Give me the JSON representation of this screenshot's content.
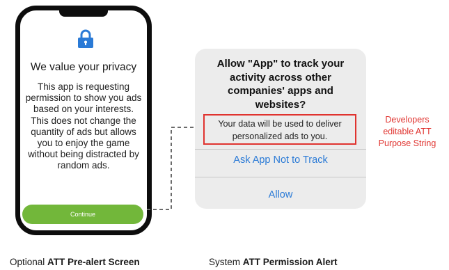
{
  "pre_alert": {
    "title": "We value your privacy",
    "body": "This app is requesting permission to show you ads based on your interests. This does not change the quantity of ads but allows you to enjoy the game without being distracted by random ads.",
    "continue_label": "Continue",
    "icon": "lock-icon",
    "accent_color": "#2a7ad6",
    "button_color": "#72b73a"
  },
  "att_alert": {
    "title": "Allow \"App\" to track your activity across other companies' apps and websites?",
    "purpose_string": "Your data will be used to deliver personalized ads to you.",
    "ask_not_to_track_label": "Ask App Not to Track",
    "allow_label": "Allow",
    "highlight_color": "#e0332f"
  },
  "annotation": {
    "text": "Developers editable ATT Purpose String"
  },
  "captions": {
    "left_prefix": "Optional ",
    "left_bold": "ATT Pre-alert Screen",
    "right_prefix": "System ",
    "right_bold": "ATT Permission Alert"
  }
}
